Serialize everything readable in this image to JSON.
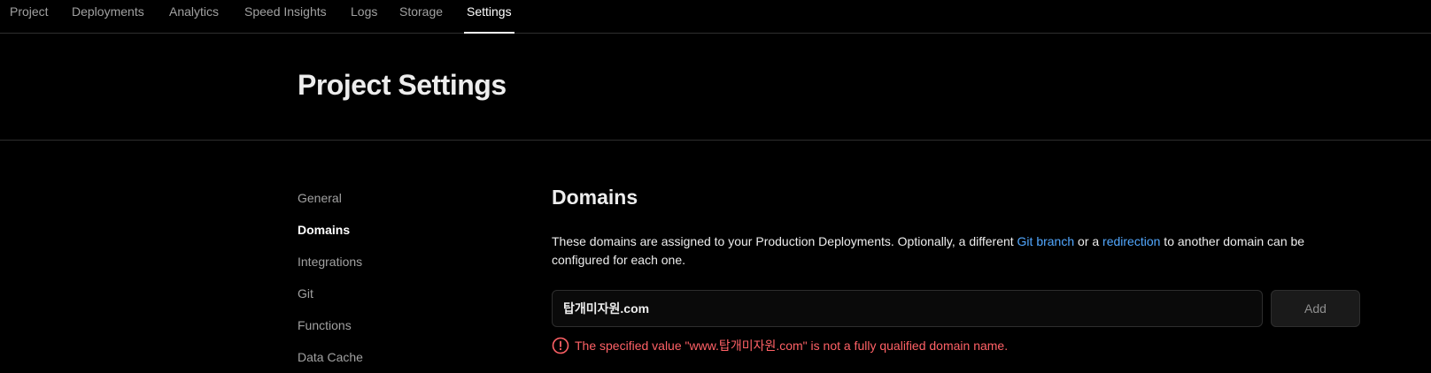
{
  "nav": {
    "tabs": [
      {
        "label": "Project"
      },
      {
        "label": "Deployments"
      },
      {
        "label": "Analytics"
      },
      {
        "label": "Speed Insights"
      },
      {
        "label": "Logs"
      },
      {
        "label": "Storage"
      },
      {
        "label": "Settings",
        "active": true
      }
    ]
  },
  "header": {
    "title": "Project Settings"
  },
  "sidebar": {
    "items": [
      {
        "label": "General"
      },
      {
        "label": "Domains",
        "active": true
      },
      {
        "label": "Integrations"
      },
      {
        "label": "Git"
      },
      {
        "label": "Functions"
      },
      {
        "label": "Data Cache"
      }
    ]
  },
  "domains": {
    "title": "Domains",
    "description_part1": "These domains are assigned to your Production Deployments. Optionally, a different ",
    "link_git_branch": "Git branch",
    "description_part2": " or a ",
    "link_redirection": "redirection",
    "description_part3": " to another domain can be configured for each one.",
    "input_value": "탑개미자원.com",
    "add_button_label": "Add",
    "error_message": "The specified value \"www.탑개미자원.com\" is not a fully qualified domain name."
  },
  "colors": {
    "background": "#000000",
    "link": "#52a8ff",
    "error": "#ff6166",
    "muted_text": "#a1a1a1"
  },
  "icons": {
    "error": "error-circle-icon"
  }
}
